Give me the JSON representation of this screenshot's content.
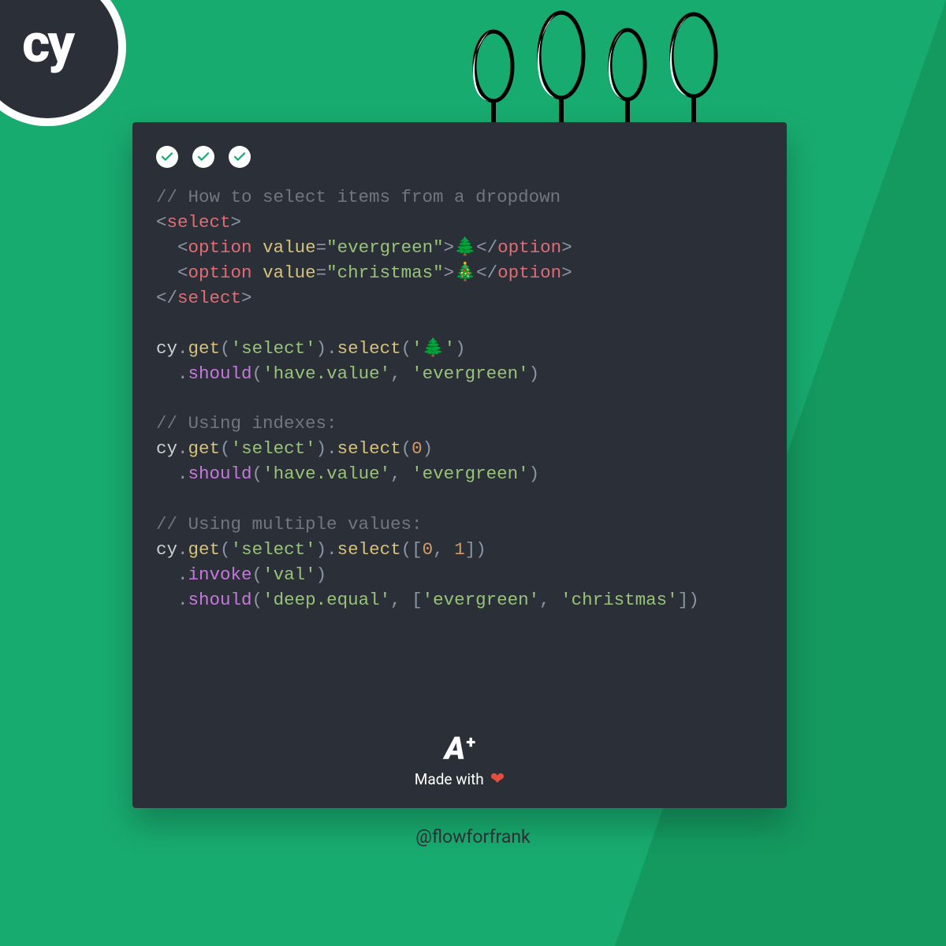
{
  "logo": {
    "text": "cy"
  },
  "checks_count": 3,
  "code": {
    "comment1": "// How to select items from a dropdown",
    "html": {
      "select_open": "select",
      "option1_attr": "value",
      "option1_val": "\"evergreen\"",
      "option1_emoji": "🌲",
      "option2_attr": "value",
      "option2_val": "\"christmas\"",
      "option2_emoji": "🎄",
      "option_tag": "option",
      "select_close": "select"
    },
    "line_cy1a": "cy",
    "line_get": "get",
    "line_select_arg": "'select'",
    "line_select_fn": "select",
    "line_tree_arg": "'🌲'",
    "line_should": "should",
    "line_havevalue": "'have.value'",
    "line_evergreen": "'evergreen'",
    "comment2": "// Using indexes:",
    "idx_arg": "0",
    "comment3": "// Using multiple values:",
    "arr_open": "[",
    "arr_0": "0",
    "arr_1": "1",
    "arr_close": "]",
    "invoke": "invoke",
    "val": "'val'",
    "deep_equal": "'deep.equal'",
    "christmas": "'christmas'"
  },
  "brand": {
    "a": "A",
    "plus": "+",
    "made": "Made with",
    "heart": "❤"
  },
  "handle": "@flowforfrank"
}
